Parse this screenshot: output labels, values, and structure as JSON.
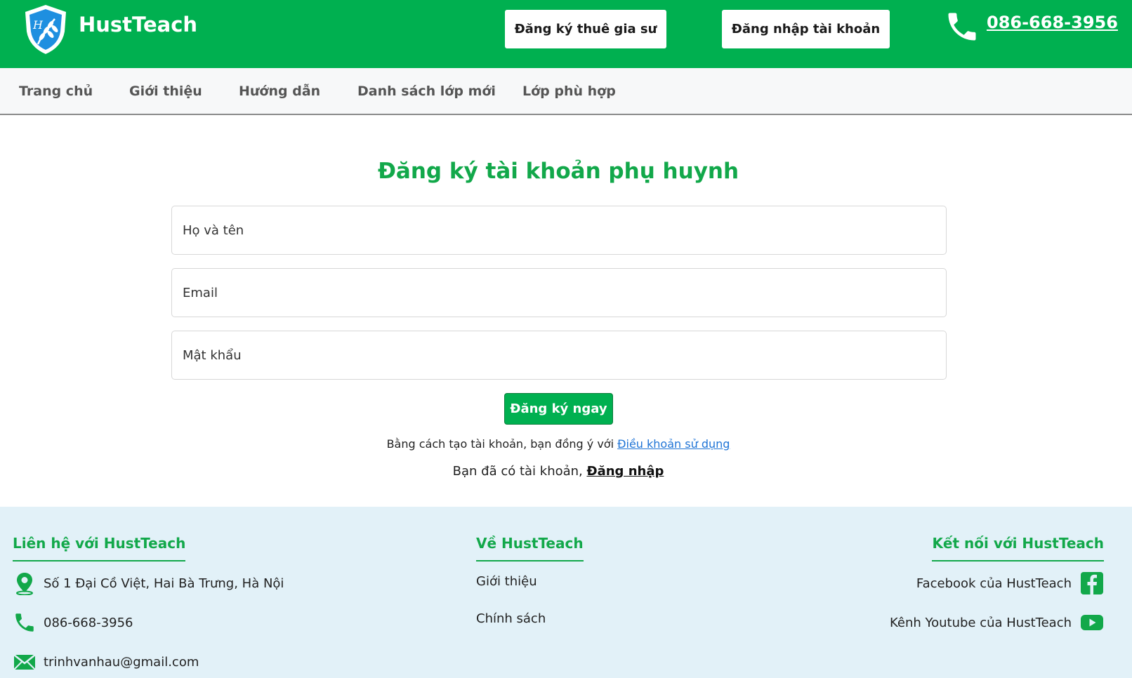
{
  "header": {
    "brand": "HustTeach",
    "logo_letter": "H",
    "btn_hire": "Đăng ký thuê gia sư",
    "btn_login": "Đăng nhập tài khoản",
    "phone": "086-668-3956",
    "bg_color": "#00b050"
  },
  "nav": {
    "items": [
      "Trang chủ",
      "Giới thiệu",
      "Hướng dẫn",
      "Danh sách lớp mới",
      "Lớp phù hợp"
    ]
  },
  "form": {
    "title": "Đăng ký tài khoản phụ huynh",
    "name_placeholder": "Họ và tên",
    "email_placeholder": "Email",
    "password_placeholder": "Mật khẩu",
    "submit_label": "Đăng ký ngay",
    "terms_text": "Bằng cách tạo tài khoản, bạn đồng ý với ",
    "terms_link": "Điều khoản sử dụng",
    "login_text": "Bạn đã có tài khoản, ",
    "login_link": "Đăng nhập"
  },
  "footer": {
    "contact": {
      "heading": "Liên hệ với HustTeach",
      "address": "Số 1 Đại Cồ Việt, Hai Bà Trưng, Hà Nội",
      "phone": "086-668-3956",
      "email": "trinhvanhau@gmail.com"
    },
    "about": {
      "heading": "Về HustTeach",
      "links": [
        "Giới thiệu",
        "Chính sách"
      ]
    },
    "social": {
      "heading": "Kết nối với HustTeach",
      "facebook": "Facebook của HustTeach",
      "youtube": "Kênh Youtube của HustTeach"
    },
    "bg_color": "#e2f1f8"
  },
  "icons": [
    "shield-logo-icon",
    "phone-icon",
    "location-pin-icon",
    "mail-icon",
    "facebook-icon",
    "youtube-icon"
  ],
  "accent_color": "#12a84a"
}
